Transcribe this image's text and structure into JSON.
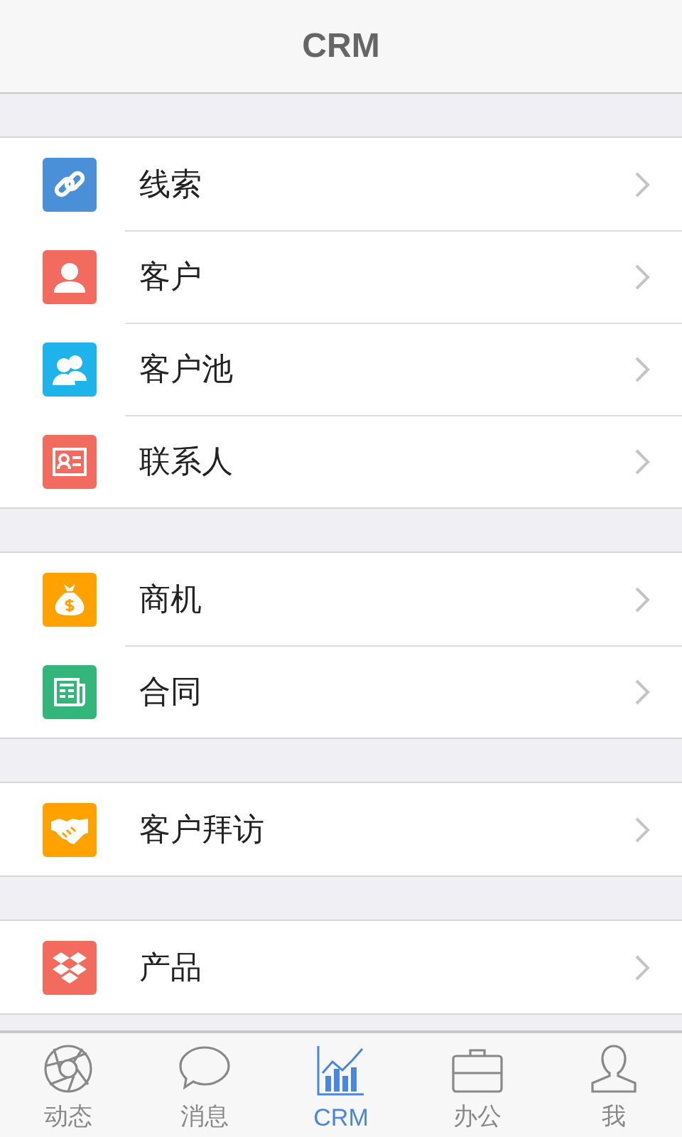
{
  "header": {
    "title": "CRM"
  },
  "groups": [
    {
      "items": [
        {
          "label": "线索",
          "kind": "link",
          "color": "#4a90d9"
        },
        {
          "label": "客户",
          "kind": "person",
          "color": "#f26b5e"
        },
        {
          "label": "客户池",
          "kind": "people",
          "color": "#1fb3ec"
        },
        {
          "label": "联系人",
          "kind": "card",
          "color": "#f26b5e"
        }
      ]
    },
    {
      "items": [
        {
          "label": "商机",
          "kind": "moneybag",
          "color": "#ffa200"
        },
        {
          "label": "合同",
          "kind": "newspaper",
          "color": "#34b67a"
        }
      ]
    },
    {
      "items": [
        {
          "label": "客户拜访",
          "kind": "handshake",
          "color": "#ffa200"
        }
      ]
    },
    {
      "items": [
        {
          "label": "产品",
          "kind": "boxes",
          "color": "#f26b5e"
        }
      ]
    }
  ],
  "tabs": [
    {
      "label": "动态",
      "kind": "aperture",
      "selected": false
    },
    {
      "label": "消息",
      "kind": "bubble",
      "selected": false
    },
    {
      "label": "CRM",
      "kind": "chart",
      "selected": true
    },
    {
      "label": "办公",
      "kind": "briefcase",
      "selected": false
    },
    {
      "label": "我",
      "kind": "user",
      "selected": false
    }
  ]
}
